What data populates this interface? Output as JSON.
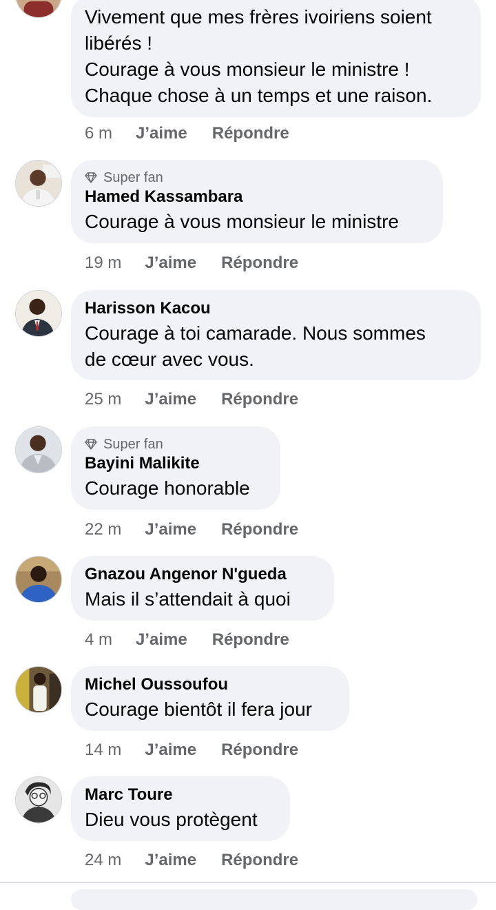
{
  "comments": [
    {
      "author": "",
      "badge": "",
      "text_lines": [
        "Vivement que mes frères ivoiriens soient",
        "libérés !",
        "Courage à vous monsieur le ministre !",
        "Chaque chose à un temps et une raison."
      ],
      "time": "6 m",
      "like": "J’aime",
      "reply": "Répondre"
    },
    {
      "author": "Hamed Kassambara",
      "badge": "Super fan",
      "text_lines": [
        "Courage à vous monsieur le ministre"
      ],
      "time": "19 m",
      "like": "J’aime",
      "reply": "Répondre"
    },
    {
      "author": "Harisson Kacou",
      "badge": "",
      "text_lines": [
        "Courage à toi camarade. Nous sommes",
        "de cœur avec vous."
      ],
      "time": "25 m",
      "like": "J’aime",
      "reply": "Répondre"
    },
    {
      "author": "Bayini Malikite",
      "badge": "Super fan",
      "text_lines": [
        "Courage honorable"
      ],
      "time": "22 m",
      "like": "J’aime",
      "reply": "Répondre"
    },
    {
      "author": "Gnazou Angenor N'gueda",
      "badge": "",
      "text_lines": [
        "Mais il s’attendait à quoi"
      ],
      "time": "4 m",
      "like": "J’aime",
      "reply": "Répondre"
    },
    {
      "author": "Michel Oussoufou",
      "badge": "",
      "text_lines": [
        "Courage bientôt il fera jour"
      ],
      "time": "14 m",
      "like": "J’aime",
      "reply": "Répondre"
    },
    {
      "author": "Marc Toure",
      "badge": "",
      "text_lines": [
        "Dieu vous protègent"
      ],
      "time": "24 m",
      "like": "J’aime",
      "reply": "Répondre"
    }
  ],
  "icons": {
    "badge": "diamond-icon",
    "avatar": "profile-photo"
  },
  "colors": {
    "bubble": "#f0f2f5",
    "text": "#050505",
    "secondary": "#65676b"
  }
}
